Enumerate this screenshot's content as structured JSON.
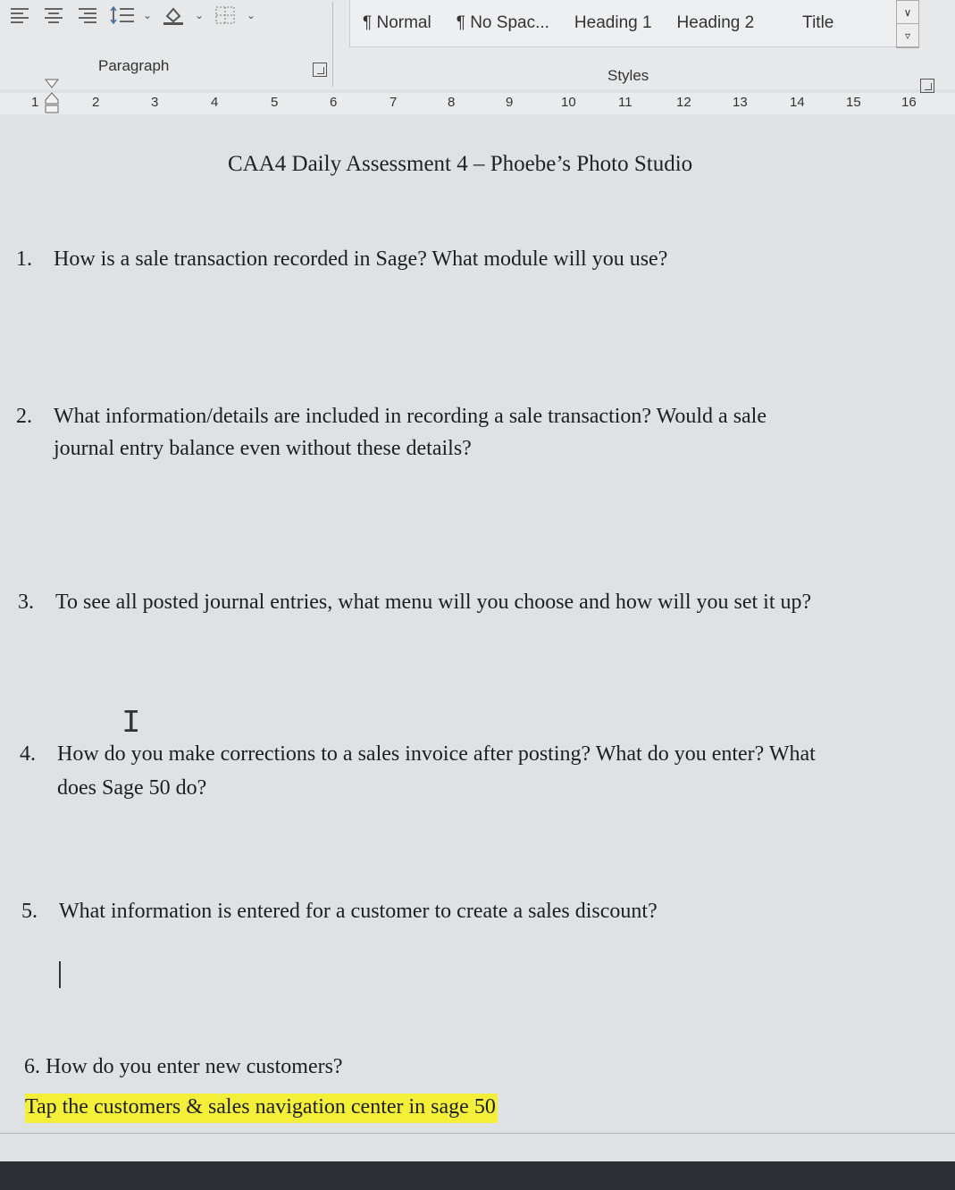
{
  "ribbon": {
    "paragraph_label": "Paragraph",
    "styles_label": "Styles",
    "styles": [
      "¶ Normal",
      "¶ No Spac...",
      "Heading 1",
      "Heading 2",
      "Title"
    ]
  },
  "ruler": {
    "numbers": [
      "1",
      "2",
      "3",
      "4",
      "5",
      "6",
      "7",
      "8",
      "9",
      "10",
      "11",
      "12",
      "13",
      "14",
      "15",
      "16"
    ]
  },
  "document": {
    "title": "CAA4 Daily Assessment 4 – Phoebe’s Photo Studio",
    "questions": [
      {
        "num": "1.",
        "text": "How is a sale transaction recorded in Sage? What module will you use?"
      },
      {
        "num": "2.",
        "text": "What information/details are included in recording a sale transaction? Would a sale",
        "text2": "journal entry balance even without these details?"
      },
      {
        "num": "3.",
        "text": "To see all posted journal entries, what menu will you choose and how will you set it up?"
      },
      {
        "num": "4.",
        "text": "How do you make corrections to a sales invoice after posting? What do you enter? What",
        "text2": "does Sage 50 do?"
      },
      {
        "num": "5.",
        "text": "What information is entered for a customer to create a sales discount?"
      }
    ],
    "q6": "6. How do you enter new customers?",
    "answer": "Tap the customers & sales navigation center in sage 50"
  },
  "colors": {
    "highlight": "#f4f03a"
  }
}
